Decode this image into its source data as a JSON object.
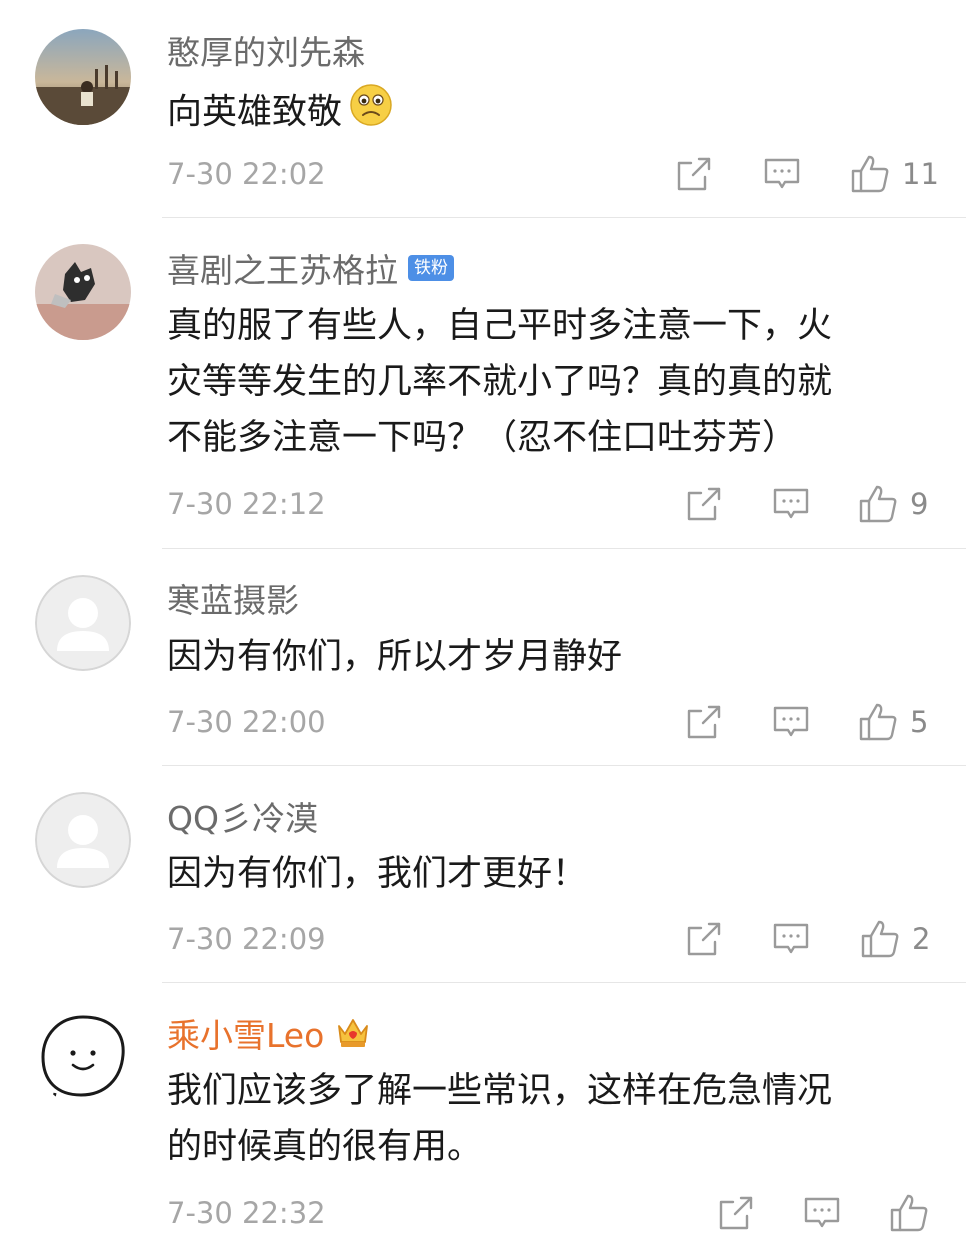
{
  "comments": [
    {
      "username": "憨厚的刘先森",
      "lines": [
        "向英雄致敬"
      ],
      "emoji": "sad-face-emoji",
      "time": "7-30 22:02",
      "likes": "11"
    },
    {
      "username": "喜剧之王苏格拉",
      "badge": "铁粉",
      "lines": [
        "真的服了有些人，自己平时多注意一下，火",
        "灾等等发生的几率不就小了吗？真的真的就",
        "不能多注意一下吗？（忍不住口吐芬芳）"
      ],
      "time": "7-30 22:12",
      "likes": "9"
    },
    {
      "username": "寒蓝摄影",
      "lines": [
        "因为有你们，所以才岁月静好"
      ],
      "time": "7-30 22:00",
      "likes": "5"
    },
    {
      "username": "QQ彡冷漠",
      "lines": [
        "因为有你们，我们才更好！"
      ],
      "time": "7-30 22:09",
      "likes": "2"
    },
    {
      "username": "乘小雪Leo",
      "badge_icon": "crown-vip-icon",
      "lines": [
        "我们应该多了解一些常识，这样在危急情况",
        "的时候真的很有用。"
      ],
      "time": "7-30 22:32",
      "likes": ""
    }
  ],
  "icons": {
    "share": "share-icon",
    "reply": "comment-icon",
    "like": "thumbs-up-icon"
  },
  "colors": {
    "username": "#6b6b6b",
    "vip_username": "#e8722c",
    "badge_bg": "#4d8fe6",
    "timestamp": "#a6a6a6",
    "divider": "#e6e6e6"
  }
}
